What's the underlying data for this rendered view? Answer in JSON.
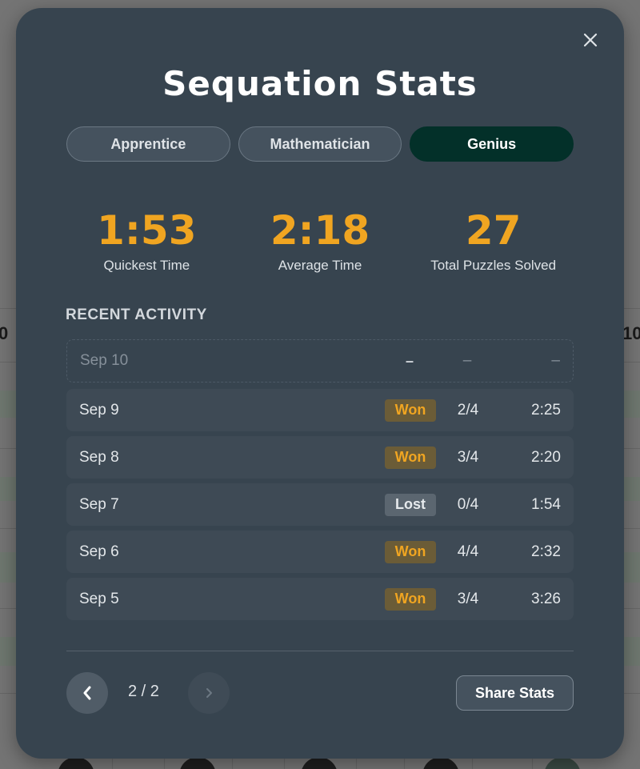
{
  "background": {
    "left_edge_number": "0",
    "right_edge_number": "10"
  },
  "modal": {
    "title": "Sequation Stats",
    "close_icon": "close-icon"
  },
  "tabs": [
    {
      "label": "Apprentice",
      "active": false
    },
    {
      "label": "Mathematician",
      "active": false
    },
    {
      "label": "Genius",
      "active": true
    }
  ],
  "stats": [
    {
      "value": "1:53",
      "label": "Quickest Time"
    },
    {
      "value": "2:18",
      "label": "Average Time"
    },
    {
      "value": "27",
      "label": "Total Puzzles Solved"
    }
  ],
  "recent_activity": {
    "title": "RECENT ACTIVITY",
    "rows": [
      {
        "date": "Sep 10",
        "result": "–",
        "score": "–",
        "time": "–",
        "status": "pending"
      },
      {
        "date": "Sep 9",
        "result": "Won",
        "score": "2/4",
        "time": "2:25",
        "status": "won"
      },
      {
        "date": "Sep 8",
        "result": "Won",
        "score": "3/4",
        "time": "2:20",
        "status": "won"
      },
      {
        "date": "Sep 7",
        "result": "Lost",
        "score": "0/4",
        "time": "1:54",
        "status": "lost"
      },
      {
        "date": "Sep 6",
        "result": "Won",
        "score": "4/4",
        "time": "2:32",
        "status": "won"
      },
      {
        "date": "Sep 5",
        "result": "Won",
        "score": "3/4",
        "time": "3:26",
        "status": "won"
      }
    ]
  },
  "pagination": {
    "prev_icon": "chevron-left-icon",
    "next_icon": "chevron-right-icon",
    "page_text": "2 / 2"
  },
  "share_label": "Share Stats",
  "colors": {
    "modal_bg": "#37444f",
    "accent": "#f0a521",
    "active_tab": "#033029"
  }
}
